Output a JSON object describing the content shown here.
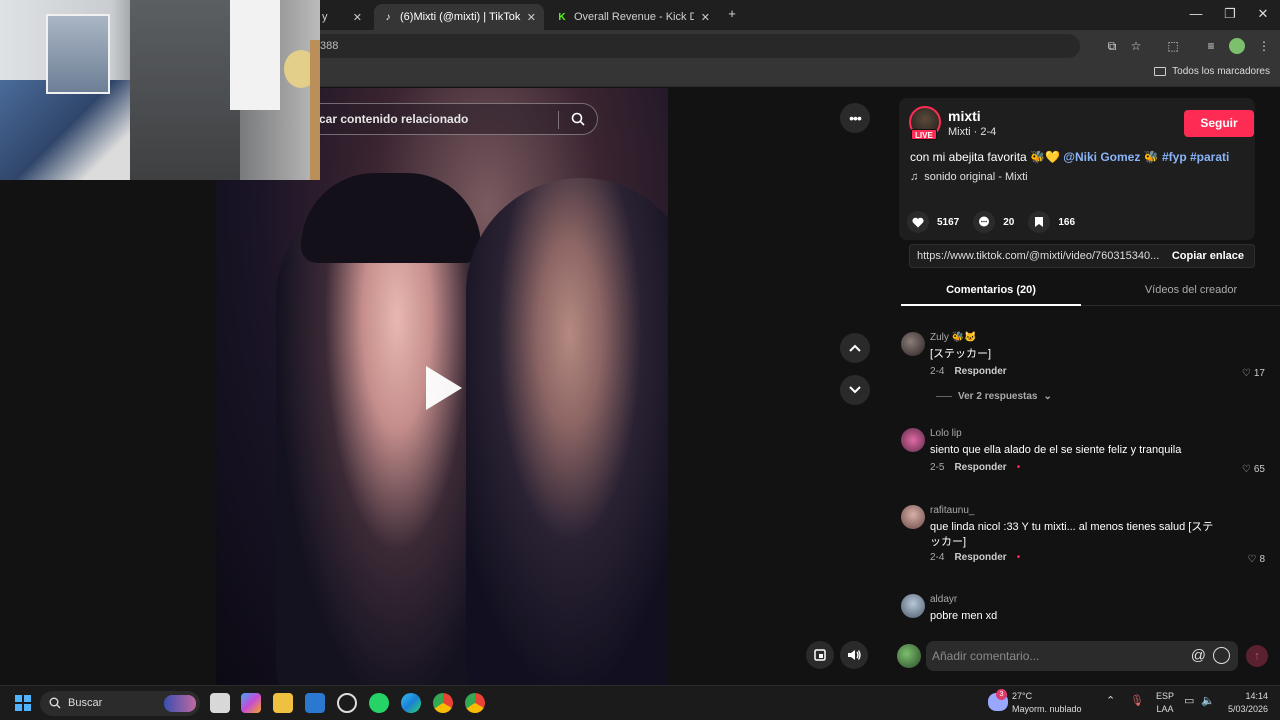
{
  "browser": {
    "tabs": [
      {
        "title": "y",
        "active": false
      },
      {
        "title": "(6)Mixti (@mixti) | TikTok",
        "active": true
      },
      {
        "title": "Overall Revenue - Kick Dashbo",
        "active": false
      }
    ],
    "url_fragment": "388",
    "bookmarks_label": "Todos los marcadores"
  },
  "video": {
    "search_placeholder": "car contenido relacionado"
  },
  "author": {
    "username": "mixti",
    "subtitle": "Mixti · 2-4",
    "live_label": "LIVE",
    "follow_label": "Seguir",
    "caption_text": "con mi abejita favorita 🐝💛",
    "caption_mention": "@Niki Gomez",
    "caption_tags": "🐝 #fyp #parati",
    "sound": "sonido original - Mixti"
  },
  "stats": {
    "likes": "5167",
    "comments": "20",
    "saves": "166"
  },
  "link": {
    "url": "https://www.tiktok.com/@mixti/video/760315340...",
    "copy_label": "Copiar enlace"
  },
  "panel_tabs": {
    "comments": "Comentarios (20)",
    "creator_videos": "Vídeos del creador"
  },
  "comments": [
    {
      "user": "Zuly 🐝🐱",
      "text": "[ステッカー]",
      "date": "2-4",
      "reply": "Responder",
      "likes": "17",
      "view_replies": "Ver 2 respuestas"
    },
    {
      "user": "Lolo lip",
      "text": "siento que ella alado de el se siente feliz y tranquila",
      "date": "2-5",
      "reply": "Responder",
      "likes": "65"
    },
    {
      "user": "rafitaunu_",
      "text": "que linda nicol :33 Y tu mixti... al menos tienes salud [ステッカー]",
      "date": "2-4",
      "reply": "Responder",
      "likes": "8"
    },
    {
      "user": "aldayr",
      "text": "pobre men xd"
    }
  ],
  "comment_input": {
    "placeholder": "Añadir comentario..."
  },
  "taskbar": {
    "search_label": "Buscar",
    "weather_temp": "27°C",
    "weather_desc": "Mayorm. nublado",
    "lang_1": "ESP",
    "lang_2": "LAA",
    "time": "14:14",
    "date": "5/03/2026",
    "notification_count": "3"
  },
  "colors": {
    "accent": "#fe2c55",
    "link": "#8ab4f8"
  }
}
